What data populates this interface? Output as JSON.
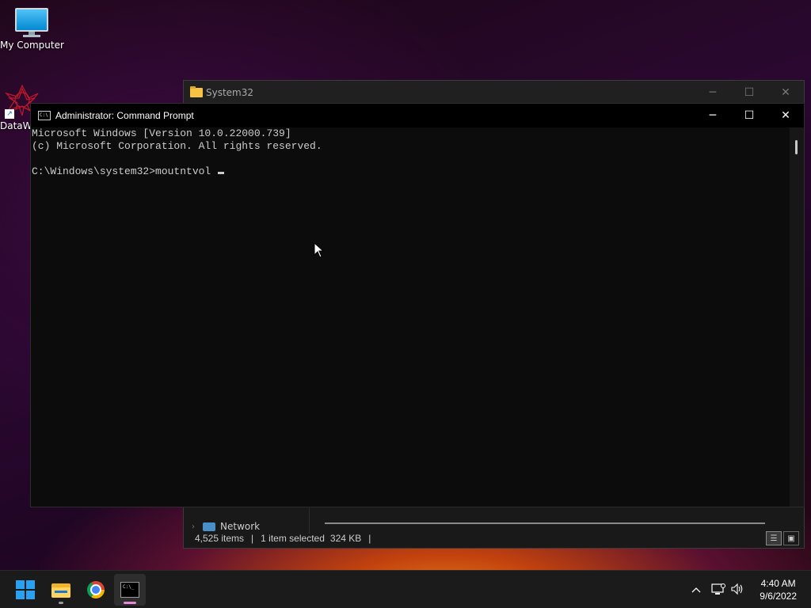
{
  "desktop": {
    "icons": [
      {
        "label": "My Computer",
        "icon": "monitor-icon"
      },
      {
        "label": "DataW",
        "icon": "datawrapper-shortcut-icon"
      }
    ]
  },
  "explorer": {
    "title": "System32",
    "nav_item": "Network",
    "status": {
      "items": "4,525 items",
      "selected": "1 item selected",
      "size": "324 KB"
    }
  },
  "cmd": {
    "title": "Administrator: Command Prompt",
    "lines": [
      "Microsoft Windows [Version 10.0.22000.739]",
      "(c) Microsoft Corporation. All rights reserved.",
      "",
      "C:\\Windows\\system32>moutntvol "
    ]
  },
  "window_controls": {
    "minimize": "─",
    "maximize": "☐",
    "close": "✕"
  },
  "taskbar": {
    "apps": [
      {
        "name": "start",
        "icon": "windows-start-icon"
      },
      {
        "name": "file-explorer",
        "icon": "file-explorer-icon"
      },
      {
        "name": "chrome",
        "icon": "chrome-icon"
      },
      {
        "name": "command-prompt",
        "icon": "command-prompt-icon",
        "active": true
      }
    ],
    "tray": {
      "chevron": "^",
      "time": "4:40 AM",
      "date": "9/6/2022"
    }
  },
  "colors": {
    "accent": "#2aa0f0",
    "cmd_bg": "#0c0c0c",
    "console_text": "#cccccc",
    "taskbar_bg": "#1b1b1b"
  }
}
